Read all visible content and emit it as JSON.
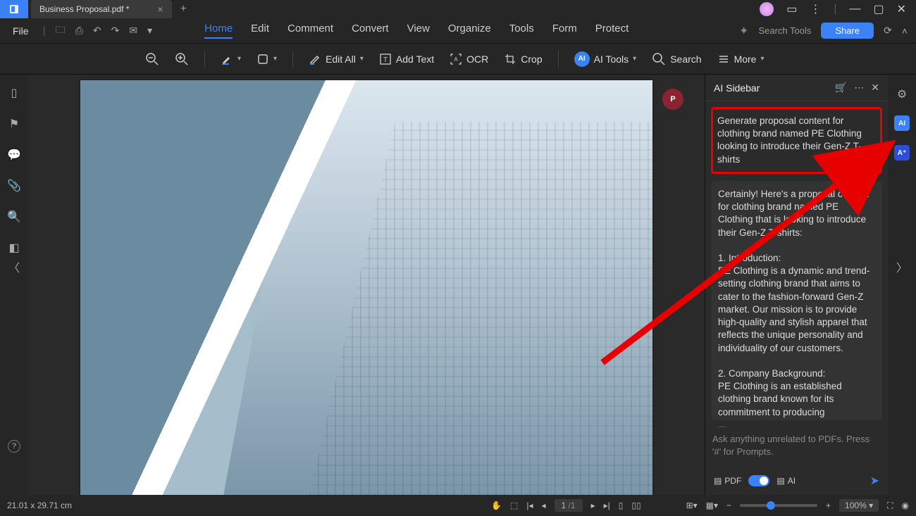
{
  "title_tab": "Business Proposal.pdf *",
  "menu": {
    "file": "File",
    "home": "Home",
    "edit": "Edit",
    "comment": "Comment",
    "convert": "Convert",
    "view": "View",
    "organize": "Organize",
    "tools": "Tools",
    "form": "Form",
    "protect": "Protect",
    "search_tools": "Search Tools",
    "share": "Share"
  },
  "toolbar": {
    "edit_all": "Edit All",
    "add_text": "Add Text",
    "ocr": "OCR",
    "crop": "Crop",
    "ai_tools": "AI Tools",
    "search": "Search",
    "more": "More"
  },
  "ai_sidebar": {
    "title": "AI Sidebar",
    "prompt": "Generate proposal content for clothing brand named PE Clothing looking to introduce their Gen-Z T-shirts",
    "reply": "Certainly! Here's a proposal content for clothing brand named PE Clothing that is looking to introduce their Gen-Z T-shirts:\n\n1. Introduction:\nPE Clothing is a dynamic and trend-setting clothing brand that aims to cater to the fashion-forward Gen-Z market. Our mission is to provide high-quality and stylish apparel that reflects the unique personality and individuality of our customers.\n\n2. Company Background:\nPE Clothing is an established clothing brand known for its commitment to producing fashionable and comfortable apparel. With several years of experience in the industry, we have built a strong",
    "placeholder": "Ask anything unrelated to PDFs. Press '#' for Prompts.",
    "pdf_label": "PDF",
    "ai_label": "AI"
  },
  "status": {
    "dims": "21.01 x 29.71 cm",
    "page": "1",
    "pages": "/1",
    "zoom": "100%"
  }
}
